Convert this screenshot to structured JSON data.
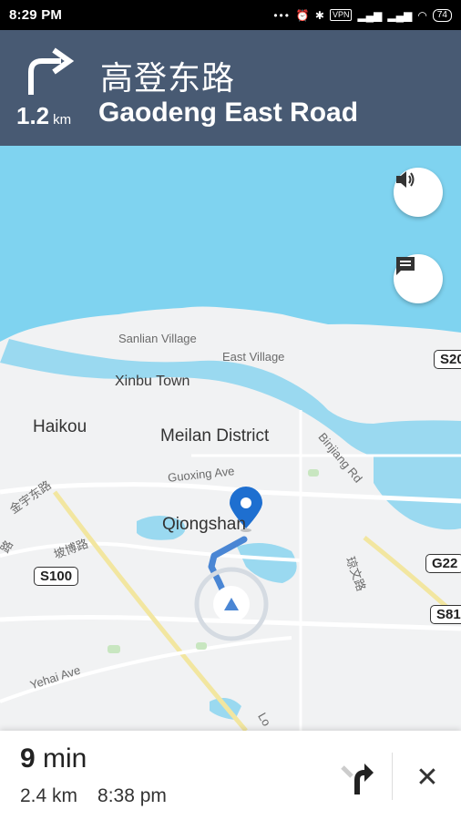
{
  "status_bar": {
    "time": "8:29 PM",
    "icons": [
      "signal-dots-icon",
      "alarm-icon",
      "bluetooth-icon",
      "vpn-icon",
      "signal-icon",
      "signal-icon",
      "wifi-icon",
      "battery-icon"
    ],
    "vpn_label": "VPN",
    "battery": "74"
  },
  "navigation": {
    "maneuver_icon": "turn-right-icon",
    "distance": "1.2",
    "distance_unit": "km",
    "street_name_cn": "高登东路",
    "street_name_en": "Gaodeng East Road"
  },
  "map": {
    "buttons": {
      "sound_icon": "volume-icon",
      "message_icon": "message-icon"
    },
    "labels": {
      "sanlian": "Sanlian Village",
      "east_village": "East Village",
      "xinbu": "Xinbu Town",
      "haikou": "Haikou",
      "meilan": "Meilan District",
      "binjiang": "Binjiang Rd",
      "guoxing": "Guoxing Ave",
      "qiongshan": "Qiongshan",
      "jinyu": "金宇东路",
      "pobo": "坡博路",
      "yehai": "Yehai Ave",
      "left_cn": "路",
      "right_cn": "琼文路",
      "lo": "Lo"
    },
    "badges": {
      "s20": "S20",
      "s100": "S100",
      "g22": "G22",
      "s81": "S81"
    },
    "colors": {
      "water": "#7fd3f0",
      "route": "#4a86d4",
      "pin": "#1e6fd0"
    }
  },
  "trip": {
    "eta_minutes": "9",
    "eta_unit": "min",
    "distance": "2.4 km",
    "arrival_time": "8:38 pm",
    "next_turn_icon": "turn-right-icon",
    "close_icon": "close-icon"
  }
}
